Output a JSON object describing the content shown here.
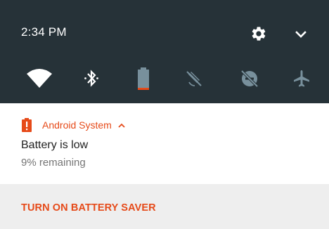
{
  "status_bar": {
    "time": "2:34 PM",
    "settings_icon": "gear-icon",
    "expand_icon": "chevron-down-icon"
  },
  "quick_settings": [
    {
      "name": "wifi",
      "icon": "wifi-icon",
      "active": true
    },
    {
      "name": "bluetooth",
      "icon": "bluetooth-icon",
      "active": true
    },
    {
      "name": "battery",
      "icon": "battery-icon",
      "active": true,
      "level": 0.09
    },
    {
      "name": "rotation",
      "icon": "rotation-off-icon",
      "active": false
    },
    {
      "name": "do-not-disturb",
      "icon": "do-not-disturb-off-icon",
      "active": false
    },
    {
      "name": "airplane-mode",
      "icon": "airplane-icon",
      "active": false
    }
  ],
  "notification": {
    "app_name": "Android System",
    "title": "Battery is low",
    "text": "9% remaining",
    "action_label": "TURN ON BATTERY SAVER"
  },
  "colors": {
    "shade_bg": "#263238",
    "accent": "#e64a19",
    "icon_active": "#ffffff",
    "icon_inactive": "#78909c",
    "action_bg": "#eeeeee"
  }
}
